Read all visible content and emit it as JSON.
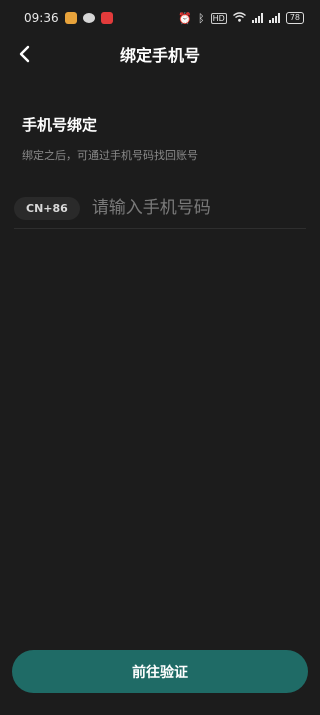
{
  "status_bar": {
    "time": "09:36",
    "battery": "78",
    "hd_label": "HD",
    "icons": [
      "weibo-icon",
      "wechat-icon",
      "app-icon",
      "alarm-icon",
      "bluetooth-icon",
      "wifi-icon",
      "signal-icon"
    ]
  },
  "header": {
    "title": "绑定手机号",
    "back_icon": "chevron-left-icon"
  },
  "section": {
    "title": "手机号绑定",
    "description": "绑定之后，可通过手机号码找回账号"
  },
  "phone_field": {
    "country_code": "CN+86",
    "value": "",
    "placeholder": "请输入手机号码"
  },
  "footer": {
    "submit_label": "前往验证"
  },
  "colors": {
    "background": "#1c1c1c",
    "accent": "#1f6b66",
    "secondary_text": "#8a8a8a"
  }
}
